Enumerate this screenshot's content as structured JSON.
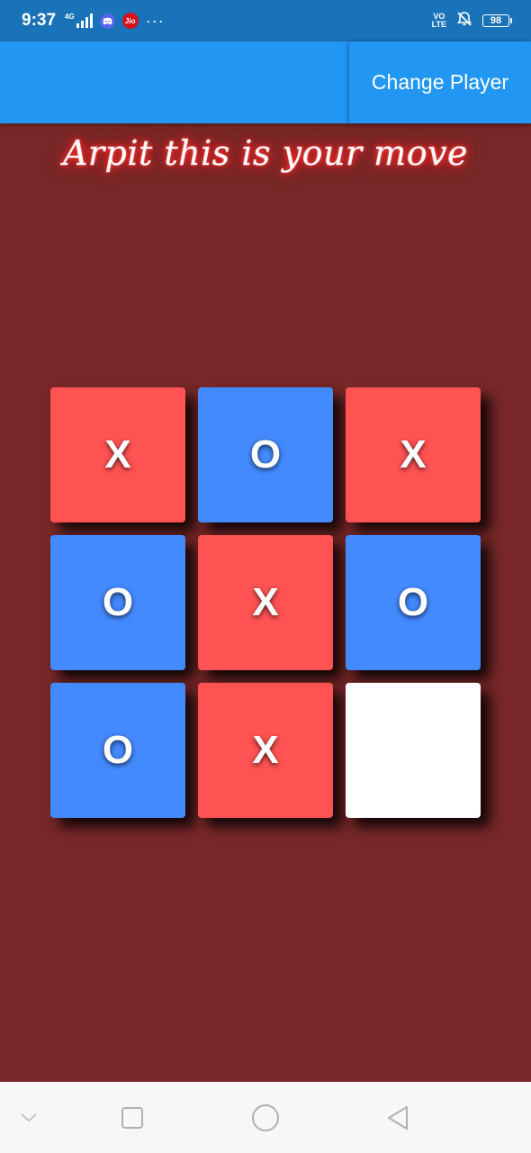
{
  "status_bar": {
    "time": "9:37",
    "network_type": "4G",
    "jio_label": "Jio",
    "more_dots": "···",
    "volte_top": "VO",
    "volte_bottom": "LTE",
    "battery": "98",
    "icons": [
      "signal-icon",
      "discord-icon",
      "jio-icon",
      "volte-icon",
      "mute-icon",
      "battery-icon"
    ]
  },
  "app_bar": {
    "change_player_label": "Change Player",
    "color": "#2196f3"
  },
  "turn_message": "Arpit  this is your move",
  "board": {
    "cells": [
      {
        "mark": "X",
        "state": "x"
      },
      {
        "mark": "O",
        "state": "o"
      },
      {
        "mark": "X",
        "state": "x"
      },
      {
        "mark": "O",
        "state": "o"
      },
      {
        "mark": "X",
        "state": "x"
      },
      {
        "mark": "O",
        "state": "o"
      },
      {
        "mark": "O",
        "state": "o"
      },
      {
        "mark": "X",
        "state": "x"
      },
      {
        "mark": "",
        "state": "empty"
      }
    ],
    "colors": {
      "x": "#ff5252",
      "o": "#448aff",
      "empty": "#ffffff",
      "background": "#772727"
    }
  },
  "nav_bar": {
    "buttons": [
      "chevron-down-icon",
      "recents-square-icon",
      "home-circle-icon",
      "back-triangle-icon"
    ]
  }
}
